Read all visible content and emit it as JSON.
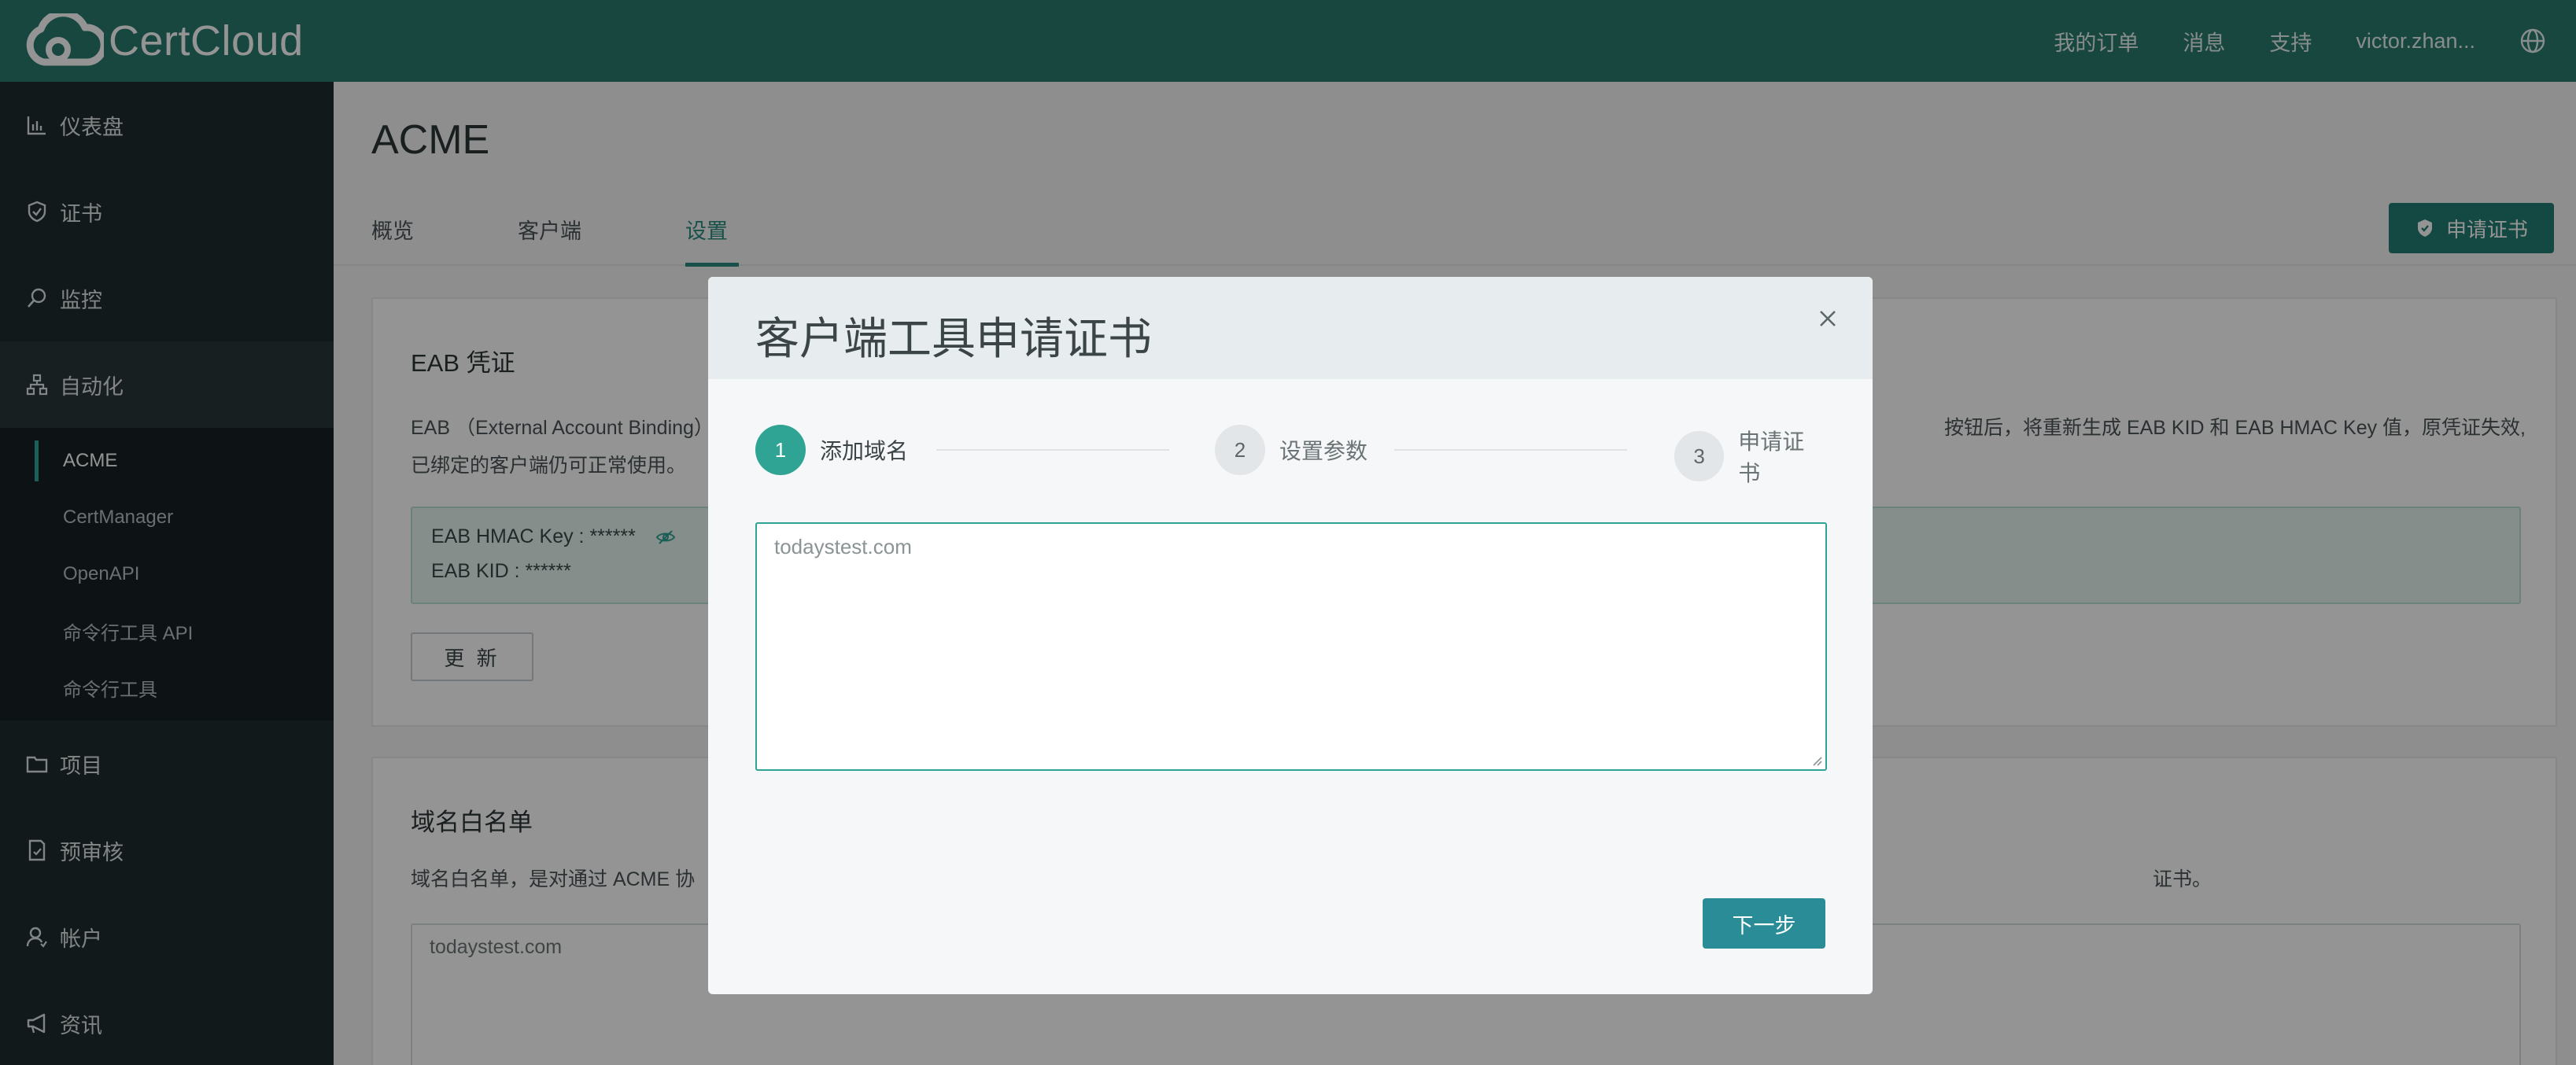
{
  "topbar": {
    "brand": "CertCloud",
    "links": [
      "我的订单",
      "消息",
      "支持",
      "victor.zhan..."
    ],
    "accent": "#2a7a6f"
  },
  "sidebar": {
    "items": [
      {
        "label": "仪表盘",
        "icon": "chart-icon"
      },
      {
        "label": "证书",
        "icon": "shield-icon"
      },
      {
        "label": "监控",
        "icon": "magnifier-icon"
      },
      {
        "label": "自动化",
        "icon": "sitemap-icon"
      },
      {
        "label": "项目",
        "icon": "folder-icon"
      },
      {
        "label": "预审核",
        "icon": "document-check-icon"
      },
      {
        "label": "帐户",
        "icon": "user-icon"
      },
      {
        "label": "资讯",
        "icon": "megaphone-icon"
      }
    ],
    "sub_items": [
      "ACME",
      "CertManager",
      "OpenAPI",
      "命令行工具 API",
      "命令行工具"
    ]
  },
  "main": {
    "title": "ACME",
    "tabs": [
      "概览",
      "客户端",
      "设置"
    ],
    "active_tab": "设置",
    "apply_button": "申请证书",
    "eab": {
      "title": "EAB 凭证",
      "desc_line1_left": "EAB （External Account Binding）",
      "desc_line1_right": "按钮后，将重新生成 EAB KID 和 EAB HMAC Key 值，原凭证失效,",
      "desc_line2": "已绑定的客户端仍可正常使用。",
      "hmac_key": "EAB HMAC Key : ******",
      "kid": "EAB KID : ******",
      "update_button": "更 新"
    },
    "whitelist": {
      "title": "域名白名单",
      "desc_left": "域名白名单，是对通过 ACME 协",
      "desc_right": "证书。",
      "placeholder": "todaystest.com"
    }
  },
  "modal": {
    "title": "客户端工具申请证书",
    "steps": [
      {
        "num": "1",
        "label": "添加域名",
        "active": true
      },
      {
        "num": "2",
        "label": "设置参数",
        "active": false
      },
      {
        "num": "3",
        "label": "申请证书",
        "active": false
      }
    ],
    "domain_placeholder": "todaystest.com",
    "next_button": "下一步"
  }
}
